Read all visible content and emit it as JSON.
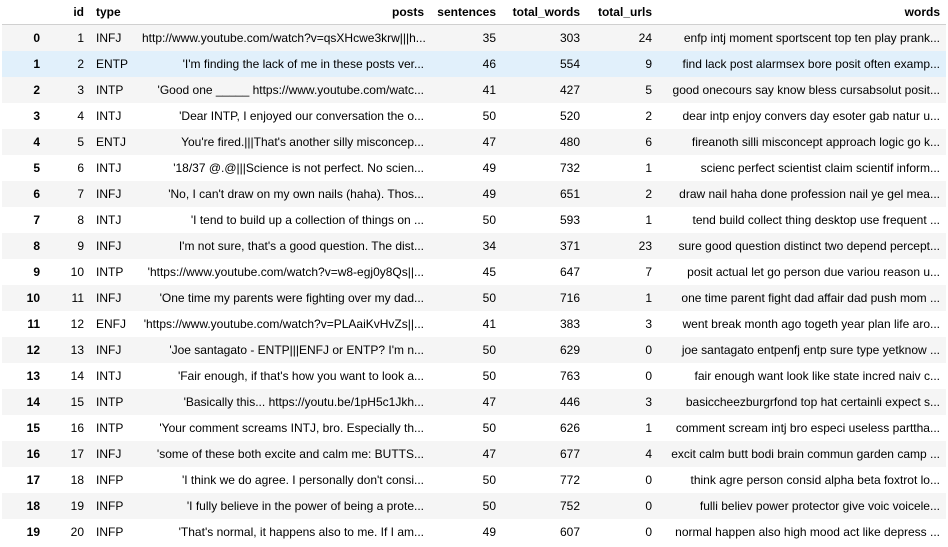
{
  "columns": [
    "",
    "id",
    "type",
    "posts",
    "sentences",
    "total_words",
    "total_urls",
    "words"
  ],
  "rows": [
    {
      "idx": "0",
      "id": "1",
      "type": "INFJ",
      "posts": "http://www.youtube.com/watch?v=qsXHcwe3krw|||h...",
      "sentences": "35",
      "total_words": "303",
      "total_urls": "24",
      "words": "enfp intj moment sportscent top ten play prank..."
    },
    {
      "idx": "1",
      "id": "2",
      "type": "ENTP",
      "posts": "'I'm finding the lack of me in these posts ver...",
      "sentences": "46",
      "total_words": "554",
      "total_urls": "9",
      "words": "find lack post alarmsex bore posit often examp..."
    },
    {
      "idx": "2",
      "id": "3",
      "type": "INTP",
      "posts": "'Good one _____ https://www.youtube.com/watc...",
      "sentences": "41",
      "total_words": "427",
      "total_urls": "5",
      "words": "good onecours say know bless cursabsolut posit..."
    },
    {
      "idx": "3",
      "id": "4",
      "type": "INTJ",
      "posts": "'Dear INTP, I enjoyed our conversation the o...",
      "sentences": "50",
      "total_words": "520",
      "total_urls": "2",
      "words": "dear intp enjoy convers day esoter gab natur u..."
    },
    {
      "idx": "4",
      "id": "5",
      "type": "ENTJ",
      "posts": "You're fired.|||That's another silly misconcep...",
      "sentences": "47",
      "total_words": "480",
      "total_urls": "6",
      "words": "fireanoth silli misconcept approach logic go k..."
    },
    {
      "idx": "5",
      "id": "6",
      "type": "INTJ",
      "posts": "'18/37 @.@|||Science is not perfect. No scien...",
      "sentences": "49",
      "total_words": "732",
      "total_urls": "1",
      "words": "scienc perfect scientist claim scientif inform..."
    },
    {
      "idx": "6",
      "id": "7",
      "type": "INFJ",
      "posts": "'No, I can't draw on my own nails (haha). Thos...",
      "sentences": "49",
      "total_words": "651",
      "total_urls": "2",
      "words": "draw nail haha done profession nail ye gel mea..."
    },
    {
      "idx": "7",
      "id": "8",
      "type": "INTJ",
      "posts": "'I tend to build up a collection of things on ...",
      "sentences": "50",
      "total_words": "593",
      "total_urls": "1",
      "words": "tend build collect thing desktop use frequent ..."
    },
    {
      "idx": "8",
      "id": "9",
      "type": "INFJ",
      "posts": "I'm not sure, that's a good question. The dist...",
      "sentences": "34",
      "total_words": "371",
      "total_urls": "23",
      "words": "sure good question distinct two depend percept..."
    },
    {
      "idx": "9",
      "id": "10",
      "type": "INTP",
      "posts": "'https://www.youtube.com/watch?v=w8-egj0y8Qs||...",
      "sentences": "45",
      "total_words": "647",
      "total_urls": "7",
      "words": "posit actual let go person due variou reason u..."
    },
    {
      "idx": "10",
      "id": "11",
      "type": "INFJ",
      "posts": "'One time my parents were fighting over my dad...",
      "sentences": "50",
      "total_words": "716",
      "total_urls": "1",
      "words": "one time parent fight dad affair dad push mom ..."
    },
    {
      "idx": "11",
      "id": "12",
      "type": "ENFJ",
      "posts": "'https://www.youtube.com/watch?v=PLAaiKvHvZs||...",
      "sentences": "41",
      "total_words": "383",
      "total_urls": "3",
      "words": "went break month ago togeth year plan life aro..."
    },
    {
      "idx": "12",
      "id": "13",
      "type": "INFJ",
      "posts": "'Joe santagato - ENTP|||ENFJ or ENTP? I'm n...",
      "sentences": "50",
      "total_words": "629",
      "total_urls": "0",
      "words": "joe santagato entpenfj entp sure type yetknow ..."
    },
    {
      "idx": "13",
      "id": "14",
      "type": "INTJ",
      "posts": "'Fair enough, if that's how you want to look a...",
      "sentences": "50",
      "total_words": "763",
      "total_urls": "0",
      "words": "fair enough want look like state incred naiv c..."
    },
    {
      "idx": "14",
      "id": "15",
      "type": "INTP",
      "posts": "'Basically this... https://youtu.be/1pH5c1Jkh...",
      "sentences": "47",
      "total_words": "446",
      "total_urls": "3",
      "words": "basiccheezburgrfond top hat certainli expect s..."
    },
    {
      "idx": "15",
      "id": "16",
      "type": "INTP",
      "posts": "'Your comment screams INTJ, bro. Especially th...",
      "sentences": "50",
      "total_words": "626",
      "total_urls": "1",
      "words": "comment scream intj bro especi useless parttha..."
    },
    {
      "idx": "16",
      "id": "17",
      "type": "INFJ",
      "posts": "'some of these both excite and calm me: BUTTS...",
      "sentences": "47",
      "total_words": "677",
      "total_urls": "4",
      "words": "excit calm butt bodi brain commun garden camp ..."
    },
    {
      "idx": "17",
      "id": "18",
      "type": "INFP",
      "posts": "'I think we do agree. I personally don't consi...",
      "sentences": "50",
      "total_words": "772",
      "total_urls": "0",
      "words": "think agre person consid alpha beta foxtrot lo..."
    },
    {
      "idx": "18",
      "id": "19",
      "type": "INFP",
      "posts": "'I fully believe in the power of being a prote...",
      "sentences": "50",
      "total_words": "752",
      "total_urls": "0",
      "words": "fulli believ power protector give voic voicele..."
    },
    {
      "idx": "19",
      "id": "20",
      "type": "INFP",
      "posts": "'That's normal, it happens also to me. If I am...",
      "sentences": "49",
      "total_words": "607",
      "total_urls": "0",
      "words": "normal happen also high mood act like depress ..."
    }
  ],
  "highlighted_row": 1
}
